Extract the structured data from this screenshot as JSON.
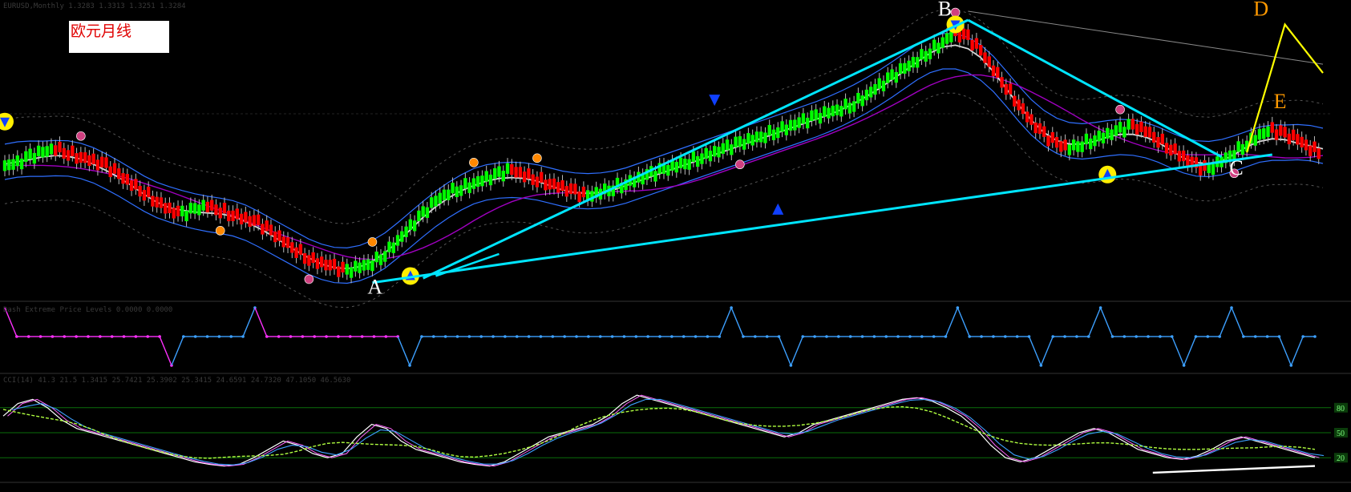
{
  "window": {
    "title": "欧元月线"
  },
  "header_legend": {
    "main": "EURUSD,Monthly  1.3283 1.3313 1.3251 1.3284",
    "indicator1": "Dash  Extreme Price Levels  0.0000  0.0000",
    "indicator2": "CCI(14)  41.3  21.5  1.3415  25.7421  25.3902  25.3415  24.6591  24.7320  47.1050  46.5630"
  },
  "colors": {
    "background": "#000000",
    "bull_candle": "#00ff00",
    "bear_candle": "#ff0000",
    "trendline": "#00e5ff",
    "band_blue": "#2f6fff",
    "ma_purple": "#a000c0",
    "osc_magenta": "#ff30ff",
    "osc_blue": "#3da0ff",
    "level_green": "#0a6e0a",
    "label_white": "#ffffff",
    "label_orange": "#ff9900",
    "wave_yellow": "#ffff00"
  },
  "chart_data": [
    {
      "type": "line",
      "panel": "price",
      "series": [
        {
          "values": [
            1.3,
            1.305,
            1.32,
            1.33,
            1.34,
            1.33,
            1.32,
            1.31,
            1.3,
            1.28,
            1.26,
            1.24,
            1.22,
            1.2,
            1.19,
            1.2,
            1.21,
            1.2,
            1.19,
            1.18,
            1.17,
            1.15,
            1.13,
            1.11,
            1.09,
            1.08,
            1.07,
            1.06,
            1.07,
            1.08,
            1.1,
            1.13,
            1.16,
            1.19,
            1.22,
            1.24,
            1.25,
            1.26,
            1.27,
            1.28,
            1.29,
            1.28,
            1.27,
            1.26,
            1.25,
            1.24,
            1.23,
            1.24,
            1.25,
            1.26,
            1.27,
            1.28,
            1.29,
            1.3,
            1.31,
            1.32,
            1.33,
            1.34,
            1.35,
            1.36,
            1.37,
            1.38,
            1.39,
            1.4,
            1.41,
            1.42,
            1.43,
            1.44,
            1.46,
            1.48,
            1.5,
            1.52,
            1.54,
            1.56,
            1.58,
            1.6,
            1.59,
            1.56,
            1.52,
            1.48,
            1.44,
            1.4,
            1.37,
            1.35,
            1.34,
            1.35,
            1.36,
            1.37,
            1.38,
            1.39,
            1.38,
            1.36,
            1.34,
            1.32,
            1.3,
            1.29,
            1.31,
            1.33,
            1.35,
            1.37,
            1.38,
            1.37,
            1.36,
            1.34,
            1.33
          ]
        }
      ],
      "annotations": [
        "A",
        "B",
        "C",
        "D",
        "E"
      ],
      "y_range": [
        1.0,
        1.65
      ]
    },
    {
      "type": "line",
      "panel": "extreme-levels",
      "series": [
        {
          "values": [
            1,
            0,
            0,
            0,
            0,
            0,
            0,
            0,
            0,
            0,
            0,
            0,
            0,
            0,
            -1,
            0,
            0,
            0,
            0,
            0,
            0,
            1,
            0,
            0,
            0,
            0,
            0,
            0,
            0,
            0,
            0,
            0,
            0,
            0,
            -1,
            0,
            0,
            0,
            0,
            0,
            0,
            0,
            0,
            0,
            0,
            0,
            0,
            0,
            0,
            0,
            0,
            0,
            0,
            0,
            0,
            0,
            0,
            0,
            0,
            0,
            0,
            1,
            0,
            0,
            0,
            0,
            -1,
            0,
            0,
            0,
            0,
            0,
            0,
            0,
            0,
            0,
            0,
            0,
            0,
            0,
            1,
            0,
            0,
            0,
            0,
            0,
            0,
            -1,
            0,
            0,
            0,
            0,
            1,
            0,
            0,
            0,
            0,
            0,
            0,
            -1,
            0,
            0,
            0,
            1,
            0,
            0,
            0,
            0,
            -1,
            0,
            0
          ]
        }
      ],
      "y_range": [
        -1,
        1
      ]
    },
    {
      "type": "line",
      "panel": "oscillator",
      "levels": [
        20,
        50,
        80
      ],
      "tick_labels": [
        "80",
        "50",
        "20"
      ],
      "series": [
        {
          "values": [
            70,
            85,
            90,
            80,
            65,
            55,
            50,
            45,
            40,
            35,
            30,
            25,
            20,
            15,
            12,
            10,
            12,
            20,
            30,
            40,
            35,
            25,
            20,
            25,
            45,
            60,
            55,
            40,
            30,
            25,
            20,
            15,
            12,
            10,
            15,
            25,
            35,
            45,
            50,
            55,
            60,
            70,
            85,
            95,
            90,
            85,
            80,
            75,
            70,
            65,
            60,
            55,
            50,
            45,
            50,
            60,
            65,
            70,
            75,
            80,
            85,
            90,
            92,
            88,
            80,
            70,
            55,
            35,
            20,
            15,
            20,
            30,
            40,
            50,
            55,
            50,
            40,
            30,
            25,
            20,
            18,
            22,
            30,
            40,
            45,
            40,
            35,
            30,
            25,
            20
          ]
        }
      ],
      "y_range": [
        0,
        100
      ]
    }
  ]
}
